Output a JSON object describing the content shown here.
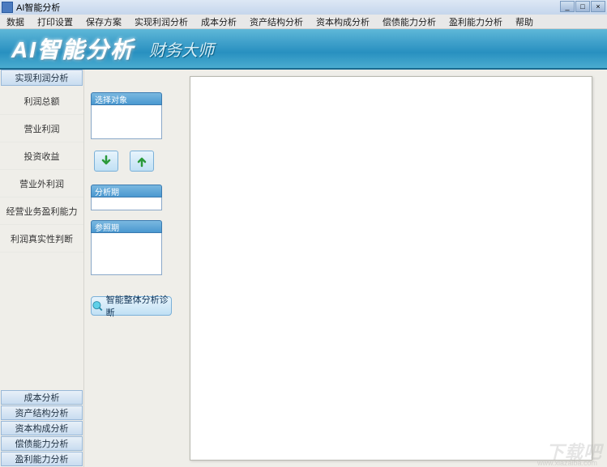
{
  "window": {
    "title": "AI智能分析"
  },
  "menu": {
    "items": [
      "数据",
      "打印设置",
      "保存方案",
      "实现利润分析",
      "成本分析",
      "资产结构分析",
      "资本构成分析",
      "偿债能力分析",
      "盈利能力分析",
      "帮助"
    ]
  },
  "banner": {
    "main": "AI智能分析",
    "sub": "财务大师"
  },
  "sidebar": {
    "active_tab": "实现利润分析",
    "nav": [
      "利润总额",
      "营业利润",
      "投资收益",
      "营业外利润",
      "经营业务盈利能力",
      "利润真实性判断"
    ],
    "bottom_tabs": [
      "成本分析",
      "资产结构分析",
      "资本构成分析",
      "偿债能力分析",
      "盈利能力分析"
    ]
  },
  "mid": {
    "group1_label": "选择对象",
    "group2_label": "分析期",
    "group3_label": "参照期",
    "analyze_btn": "智能整体分析诊断"
  },
  "watermark": {
    "main": "下载吧",
    "sub": "www.xiazaiba.com"
  }
}
